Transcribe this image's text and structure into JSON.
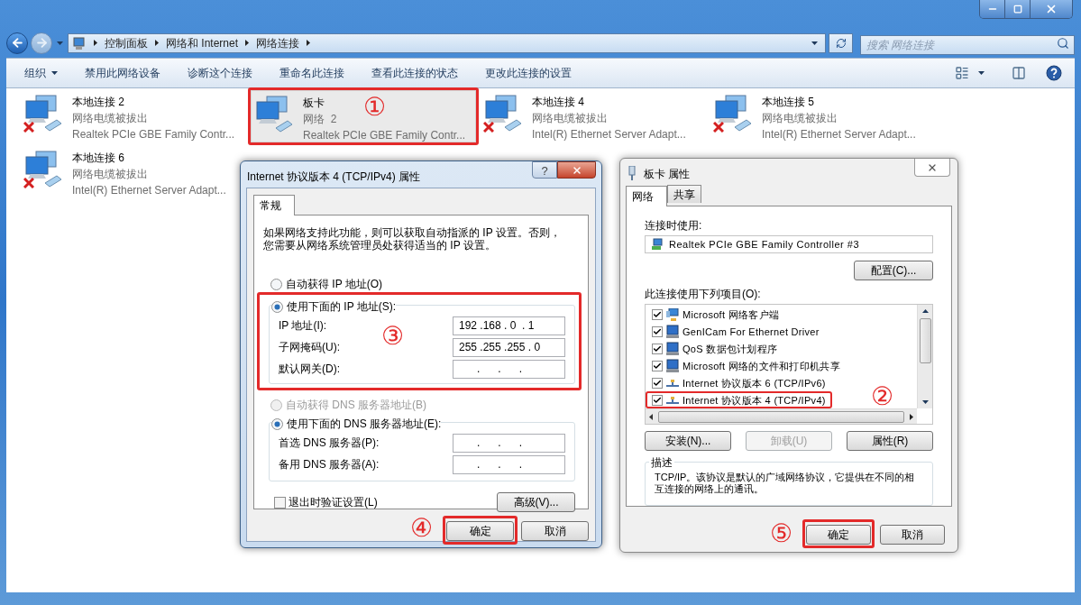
{
  "window": {
    "breadcrumb": [
      "控制面板",
      "网络和 Internet",
      "网络连接"
    ],
    "search": {
      "placeholder": "搜索 网络连接"
    }
  },
  "toolbar": [
    {
      "label": "组织",
      "kind": "menu"
    },
    {
      "label": "禁用此网络设备",
      "kind": "command"
    },
    {
      "label": "诊断这个连接",
      "kind": "command"
    },
    {
      "label": "重命名此连接",
      "kind": "command"
    },
    {
      "label": "查看此连接的状态",
      "kind": "command"
    },
    {
      "label": "更改此连接的设置",
      "kind": "command"
    }
  ],
  "connections": [
    {
      "name": "本地连接 2",
      "status": "网络电缆被拔出",
      "device": "Realtek PCIe GBE Family Contr...",
      "disconnected": true,
      "selected": false
    },
    {
      "name": "板卡",
      "status": "网络  2",
      "device": "Realtek PCIe GBE Family Contr...",
      "disconnected": false,
      "selected": true,
      "callout": "①"
    },
    {
      "name": "本地连接 4",
      "status": "网络电缆被拔出",
      "device": "Intel(R) Ethernet Server Adapt...",
      "disconnected": true,
      "selected": false
    },
    {
      "name": "本地连接 5",
      "status": "网络电缆被拔出",
      "device": "Intel(R) Ethernet Server Adapt...",
      "disconnected": true,
      "selected": false
    },
    {
      "name": "本地连接 6",
      "status": "网络电缆被拔出",
      "device": "Intel(R) Ethernet Server Adapt...",
      "disconnected": true,
      "selected": false
    }
  ],
  "ipv4_dialog": {
    "title": "Internet 协议版本 4 (TCP/IPv4) 属性",
    "help_button": "?",
    "tabs": [
      {
        "label": "常规",
        "selected": true
      }
    ],
    "intro": "如果网络支持此功能，则可以获取自动指派的 IP 设置。否则，您需要从网络系统管理员处获得适当的 IP 设置。",
    "ip_options": [
      {
        "label": "自动获得 IP 地址(O)",
        "selected": false,
        "disabled": false
      },
      {
        "label": "使用下面的 IP 地址(S):",
        "selected": true,
        "disabled": false
      }
    ],
    "ip_callout": "③",
    "ip_fields": [
      {
        "label": "IP 地址(I):",
        "value": "192 .168 . 0  . 1"
      },
      {
        "label": "子网掩码(U):",
        "value": "255 .255 .255 . 0"
      },
      {
        "label": "默认网关(D):",
        "value": "      .      .      ."
      }
    ],
    "dns_options": [
      {
        "label": "自动获得 DNS 服务器地址(B)",
        "selected": false,
        "disabled": true
      },
      {
        "label": "使用下面的 DNS 服务器地址(E):",
        "selected": true,
        "disabled": false
      }
    ],
    "dns_fields": [
      {
        "label": "首选 DNS 服务器(P):",
        "value": "      .      .      ."
      },
      {
        "label": "备用 DNS 服务器(A):",
        "value": "      .      .      ."
      }
    ],
    "validate": {
      "label": "退出时验证设置(L)",
      "checked": false
    },
    "advanced": "高级(V)...",
    "buttons": [
      {
        "label": "确定",
        "callout": "④"
      },
      {
        "label": "取消"
      }
    ]
  },
  "adapter_dialog": {
    "title": "板卡 属性",
    "tabs": [
      {
        "label": "网络",
        "selected": true
      },
      {
        "label": "共享",
        "selected": false
      }
    ],
    "connect_using_label": "连接时使用:",
    "adapter": "Realtek PCIe GBE Family Controller #3",
    "configure": "配置(C)...",
    "items_label": "此连接使用下列项目(O):",
    "items": [
      {
        "label": "Microsoft 网络客户端",
        "checked": true,
        "kind": "client"
      },
      {
        "label": "GenICam For Ethernet Driver",
        "checked": true,
        "kind": "service"
      },
      {
        "label": "QoS 数据包计划程序",
        "checked": true,
        "kind": "service"
      },
      {
        "label": "Microsoft 网络的文件和打印机共享",
        "checked": true,
        "kind": "service"
      },
      {
        "label": "Internet 协议版本 6 (TCP/IPv6)",
        "checked": true,
        "kind": "protocol"
      },
      {
        "label": "Internet 协议版本 4 (TCP/IPv4)",
        "checked": true,
        "kind": "protocol",
        "callout": "②"
      }
    ],
    "actions": [
      {
        "label": "安装(N)...",
        "disabled": false
      },
      {
        "label": "卸载(U)",
        "disabled": true
      },
      {
        "label": "属性(R)",
        "disabled": false
      }
    ],
    "description_label": "描述",
    "description": "TCP/IP。该协议是默认的广域网络协议，它提供在不同的相互连接的网络上的通讯。",
    "buttons": [
      {
        "label": "确定",
        "callout": "⑤"
      },
      {
        "label": "取消"
      }
    ]
  }
}
